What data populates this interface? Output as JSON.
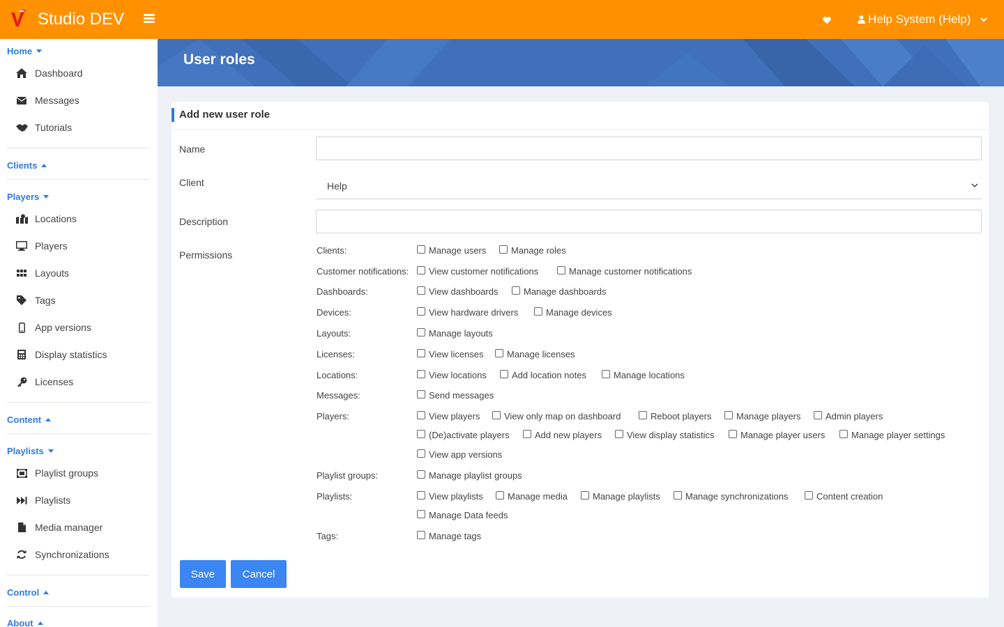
{
  "header": {
    "brand": "Studio DEV",
    "user_label": "Help System (Help)",
    "colors": {
      "bar": "#ff9100",
      "accent": "#2f7be6"
    }
  },
  "sidebar": {
    "home": "Home",
    "dashboard": "Dashboard",
    "messages": "Messages",
    "tutorials": "Tutorials",
    "clients": "Clients",
    "players_head": "Players",
    "locations": "Locations",
    "players": "Players",
    "layouts": "Layouts",
    "tags": "Tags",
    "app_versions": "App versions",
    "display_statistics": "Display statistics",
    "licenses": "Licenses",
    "content": "Content",
    "playlists_head": "Playlists",
    "playlist_groups": "Playlist groups",
    "playlists": "Playlists",
    "media_manager": "Media manager",
    "synchronizations": "Synchronizations",
    "control": "Control",
    "about": "About"
  },
  "page": {
    "title": "User roles"
  },
  "form": {
    "title": "Add new user role",
    "name_label": "Name",
    "name_value": "",
    "client_label": "Client",
    "client_value": "Help",
    "description_label": "Description",
    "description_value": "",
    "permissions_label": "Permissions",
    "save": "Save",
    "cancel": "Cancel"
  },
  "permissions": [
    {
      "group": "Clients:",
      "items": [
        "Manage users",
        "Manage roles"
      ]
    },
    {
      "group": "Customer notifications:",
      "items": [
        "View customer notifications",
        "Manage customer notifications"
      ]
    },
    {
      "group": "Dashboards:",
      "items": [
        "View dashboards",
        "Manage dashboards"
      ]
    },
    {
      "group": "Devices:",
      "items": [
        "View hardware drivers",
        "Manage devices"
      ]
    },
    {
      "group": "Layouts:",
      "items": [
        "Manage layouts"
      ]
    },
    {
      "group": "Licenses:",
      "items": [
        "View licenses",
        "Manage licenses"
      ]
    },
    {
      "group": "Locations:",
      "items": [
        "View locations",
        "Add location notes",
        "Manage locations"
      ]
    },
    {
      "group": "Messages:",
      "items": [
        "Send messages"
      ]
    },
    {
      "group": "Players:",
      "items": [
        "View players",
        "View only map on dashboard",
        "Reboot players",
        "Manage players",
        "Admin players",
        "(De)activate players",
        "Add new players",
        "View display statistics",
        "Manage player users",
        "Manage player settings",
        "View app versions"
      ]
    },
    {
      "group": "Playlist groups:",
      "items": [
        "Manage playlist groups"
      ]
    },
    {
      "group": "Playlists:",
      "items": [
        "View playlists",
        "Manage media",
        "Manage playlists",
        "Manage synchronizations",
        "Content creation",
        "Manage Data feeds"
      ]
    },
    {
      "group": "Tags:",
      "items": [
        "Manage tags"
      ]
    }
  ]
}
